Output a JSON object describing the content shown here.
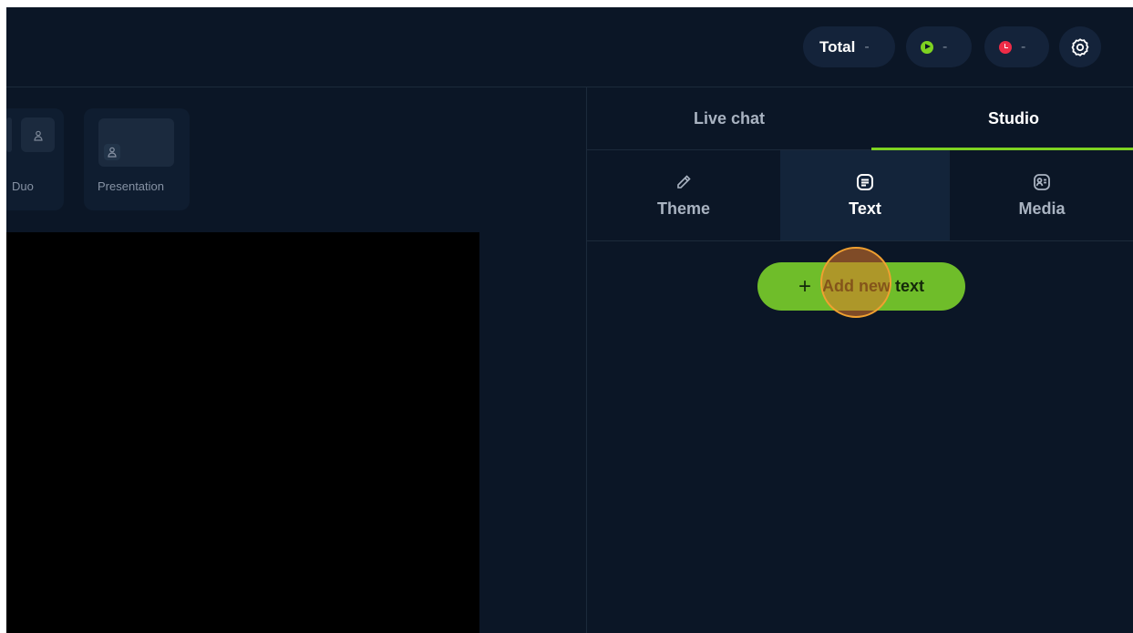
{
  "header": {
    "stats": [
      {
        "label": "Total",
        "value": "-"
      },
      {
        "icon": "live-play-icon",
        "value": "-",
        "color": "#7ed321"
      },
      {
        "icon": "recording-clock-icon",
        "value": "-",
        "color": "#ef2c47"
      }
    ],
    "settings_icon": "gear-icon"
  },
  "layouts": [
    {
      "label": "Duo",
      "icon": "person-icon"
    },
    {
      "label": "Presentation",
      "icon": "person-icon"
    }
  ],
  "panel": {
    "tabs": [
      {
        "label": "Live chat",
        "active": false
      },
      {
        "label": "Studio",
        "active": true
      }
    ],
    "subtabs": [
      {
        "label": "Theme",
        "icon": "pencil-icon",
        "active": false
      },
      {
        "label": "Text",
        "icon": "text-document-icon",
        "active": true
      },
      {
        "label": "Media",
        "icon": "media-card-icon",
        "active": false
      }
    ],
    "add_button": {
      "label": "Add new text",
      "icon": "plus-icon"
    }
  },
  "colors": {
    "background": "#0b1626",
    "accent": "#7ed321",
    "record": "#ef2c47"
  }
}
